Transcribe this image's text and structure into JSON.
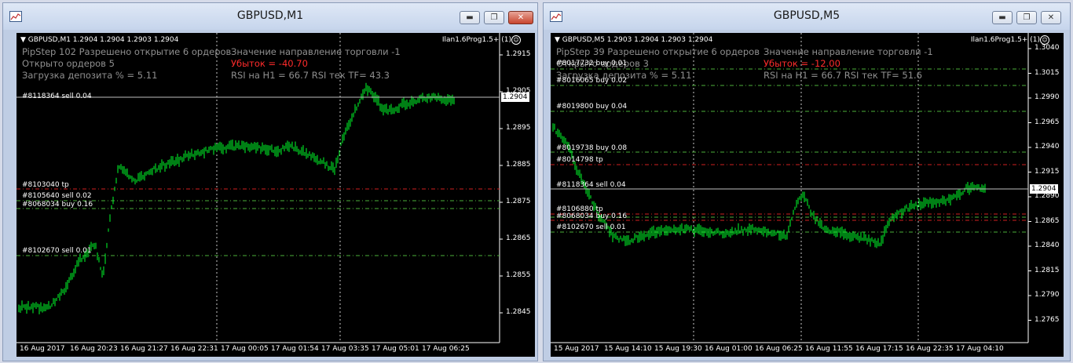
{
  "colors": {
    "candle": "#00ff2a",
    "red_line": "#e02020",
    "green_line": "#4caf3a",
    "bid_line": "#c0c0c0",
    "grid": "#c8c8c8"
  },
  "windows": [
    {
      "title": "GBPUSD,M1",
      "header": "▼ GBPUSD,M1  1.2904 1.2904 1.2903 1.2904",
      "ea_name": "Ilan1.6Prog1.5+ (1)",
      "info": [
        "PipStep 102 Разрешено открытие 6 ордеров",
        "Открыто ордеров 5",
        "Загрузка депозита % = 5.11"
      ],
      "info2": [
        "Значение направление торговли -1",
        "Убыток = -40.70",
        "RSI на H1 = 66.7  RSI тек TF= 43.3"
      ],
      "orders": [
        "#8118364 sell 0.04",
        "#8103040 tp",
        "#8105640 sell 0.02",
        "#8068034 buy 0.16",
        "#8102670 sell 0.01"
      ],
      "price_labels": [
        "1.2915",
        "1.2905",
        "1.2895",
        "1.2885",
        "1.2875",
        "1.2865",
        "1.2855",
        "1.2845"
      ],
      "current_price": "1.2904",
      "time_labels": [
        "16 Aug 2017",
        "16 Aug 20:23",
        "16 Aug 21:27",
        "16 Aug 22:31",
        "17 Aug 00:05",
        "17 Aug 01:54",
        "17 Aug 03:35",
        "17 Aug 05:01",
        "17 Aug 06:25"
      ]
    },
    {
      "title": "GBPUSD,M5",
      "header": "▼ GBPUSD,M5  1.2903 1.2904 1.2903 1.2904",
      "ea_name": "Ilan1.6Prog1.5+ (1)",
      "info": [
        "PipStep 39 Разрешено открытие 6 ордеров",
        "Открыто ордеров 3",
        "Загрузка депозита % = 5.11"
      ],
      "info2": [
        "Значение направление торговли -1",
        "Убыток = -12.00",
        "RSI на H1 = 66.7  RSI тек TF= 51.6"
      ],
      "orders": [
        "#8017732 buy 0.01",
        "#8016065 buy 0.02",
        "#8019800 buy 0.04",
        "#8019738 buy 0.08",
        "#8014798 tp",
        "#8118364 sell 0.04",
        "#8106880 tp",
        "#8068034 buy 0.16",
        "#8102670 sell 0.01"
      ],
      "price_labels": [
        "1.3040",
        "1.3015",
        "1.2990",
        "1.2965",
        "1.2940",
        "1.2915",
        "1.2890",
        "1.2865",
        "1.2840",
        "1.2815",
        "1.2790",
        "1.2765"
      ],
      "current_price": "1.2904",
      "time_labels": [
        "15 Aug 2017",
        "15 Aug 14:10",
        "15 Aug 19:30",
        "16 Aug 01:00",
        "16 Aug 06:25",
        "16 Aug 11:55",
        "16 Aug 17:15",
        "16 Aug 22:35",
        "17 Aug 04:10"
      ]
    }
  ]
}
